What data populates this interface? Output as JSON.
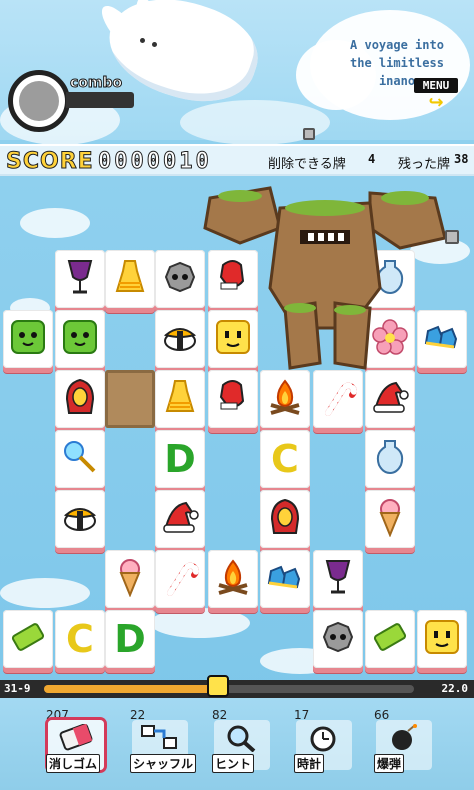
{
  "header": {
    "tagline_lines": [
      "A voyage into",
      "the limitless",
      "inano"
    ],
    "menu_label": "MENU",
    "menu_icon": "return-arrow-icon",
    "combo_label": "combo"
  },
  "score": {
    "label": "SCORE",
    "value": "0000010",
    "removable_label": "削除できる牌",
    "removable_count": "4",
    "remaining_label": "残った牌",
    "remaining_count": "38"
  },
  "board": {
    "tile_border_color": "#e6868f",
    "tiles": [
      {
        "icon": "wine-glass-icon"
      },
      {
        "icon": "yellow-dress-icon"
      },
      {
        "icon": "gray-face-icon"
      },
      {
        "icon": "red-mitten-icon"
      },
      {
        "icon": "blue-vase-icon"
      },
      {
        "icon": "green-face-icon"
      },
      {
        "icon": "green-face-icon"
      },
      {
        "icon": "sushi-icon"
      },
      {
        "icon": "yellow-face-icon"
      },
      {
        "icon": "pink-flower-icon"
      },
      {
        "icon": "blue-shoes-icon"
      },
      {
        "icon": "red-hood-icon"
      },
      {
        "icon": "yellow-dress-icon"
      },
      {
        "icon": "red-mitten-icon"
      },
      {
        "icon": "campfire-icon"
      },
      {
        "icon": "candy-cane-icon"
      },
      {
        "icon": "santa-hat-icon"
      },
      {
        "icon": "magic-wand-icon"
      },
      {
        "text": "D",
        "color": "#2aa52a"
      },
      {
        "text": "C",
        "color": "#e8c81a"
      },
      {
        "icon": "blue-vase-icon"
      },
      {
        "icon": "sushi-icon"
      },
      {
        "icon": "santa-hat-icon"
      },
      {
        "icon": "red-hood-icon"
      },
      {
        "icon": "ice-cream-icon"
      },
      {
        "icon": "ice-cream-icon"
      },
      {
        "icon": "candy-cane-icon"
      },
      {
        "icon": "campfire-icon"
      },
      {
        "icon": "blue-shoes-icon"
      },
      {
        "icon": "wine-glass-icon"
      },
      {
        "icon": "green-bar-icon"
      },
      {
        "text": "C",
        "color": "#e8c81a"
      },
      {
        "text": "D",
        "color": "#2aa52a"
      },
      {
        "icon": "gray-face-icon"
      },
      {
        "icon": "green-bar-icon"
      },
      {
        "icon": "yellow-face-icon"
      }
    ]
  },
  "progress": {
    "left_label": "31-9",
    "right_label": "22.0",
    "fraction": 0.47
  },
  "tools": [
    {
      "count": "207",
      "label": "消しゴム",
      "icon": "eraser-icon",
      "selected": true
    },
    {
      "count": "22",
      "label": "シャッフル",
      "icon": "shuffle-icon",
      "selected": false
    },
    {
      "count": "82",
      "label": "ヒント",
      "icon": "magnifier-icon",
      "selected": false
    },
    {
      "count": "17",
      "label": "時計",
      "icon": "clock-icon",
      "selected": false
    },
    {
      "count": "66",
      "label": "爆弾",
      "icon": "bomb-icon",
      "selected": false
    }
  ]
}
